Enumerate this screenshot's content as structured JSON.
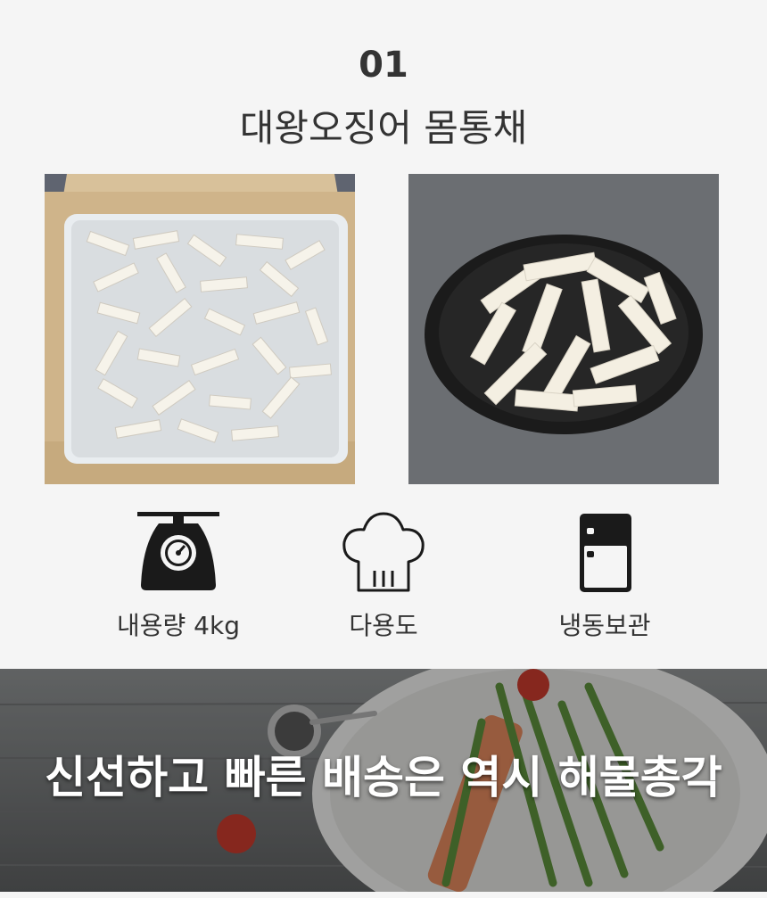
{
  "section": {
    "number": "01",
    "title": "대왕오징어 몸통채"
  },
  "photos": [
    {
      "icon": "squid-strips-in-box-photo"
    },
    {
      "icon": "squid-strips-on-plate-photo"
    }
  ],
  "features": [
    {
      "icon": "scale-icon",
      "label": "내용량 4kg"
    },
    {
      "icon": "chef-hat-icon",
      "label": "다용도"
    },
    {
      "icon": "refrigerator-icon",
      "label": "냉동보관"
    }
  ],
  "banner": {
    "text": "신선하고 빠른 배송은 역시 해물총각"
  },
  "colors": {
    "background": "#f5f5f5",
    "icon": "#1a1a1a",
    "banner_text": "#ffffff"
  }
}
